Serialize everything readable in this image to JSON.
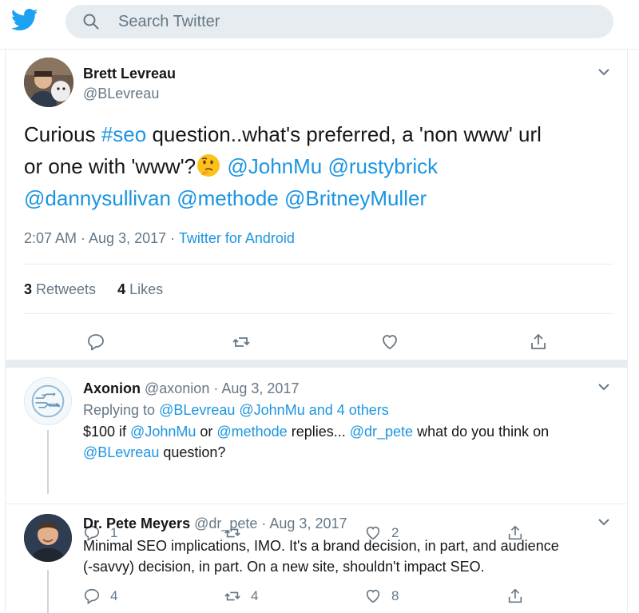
{
  "search": {
    "placeholder": "Search Twitter",
    "icon": "search-icon"
  },
  "colors": {
    "accent": "#1b95e0",
    "muted": "#657786",
    "divider": "#e6ecf0"
  },
  "tweet": {
    "author_name": "Brett Levreau",
    "author_handle": "@BLevreau",
    "text_1": "Curious ",
    "hashtag": "#seo",
    "text_2": " question..what's preferred, a 'non www' url",
    "text_3": "or one with 'www'?",
    "mention_1": "@JohnMu",
    "mention_2": "@rustybrick",
    "mention_3": "@dannysullivan",
    "mention_4": "@methode",
    "mention_5": "@BritneyMuller",
    "time": "2:07 AM · Aug 3, 2017 · ",
    "source": "Twitter for Android",
    "retweets_count": "3",
    "retweets_label": " Retweets",
    "likes_count": "4",
    "likes_label": " Likes"
  },
  "replies": [
    {
      "name": "Axonion",
      "meta": " @axonion · Aug 3, 2017",
      "replying_to": "Replying to ",
      "replying_mentions": "@BLevreau @JohnMu and 4 others",
      "line1_a": "$100 if ",
      "line1_m1": "@JohnMu",
      "line1_b": " or ",
      "line1_m2": "@methode",
      "line1_c": " replies... ",
      "line1_m3": "@dr_pete",
      "line1_d": " what do you think on",
      "line2_m": "@BLevreau",
      "line2_b": " question?",
      "reply_count": "1",
      "retweet_count": "",
      "like_count": "2"
    },
    {
      "name": "Dr. Pete Meyers",
      "meta": " @dr_pete · Aug 3, 2017",
      "line1": "Minimal SEO implications, IMO. It's a brand decision, in part, and audience",
      "line2": "(-savvy) decision, in part. On a new site, shouldn't impact SEO.",
      "reply_count": "4",
      "retweet_count": "4",
      "like_count": "8"
    }
  ]
}
